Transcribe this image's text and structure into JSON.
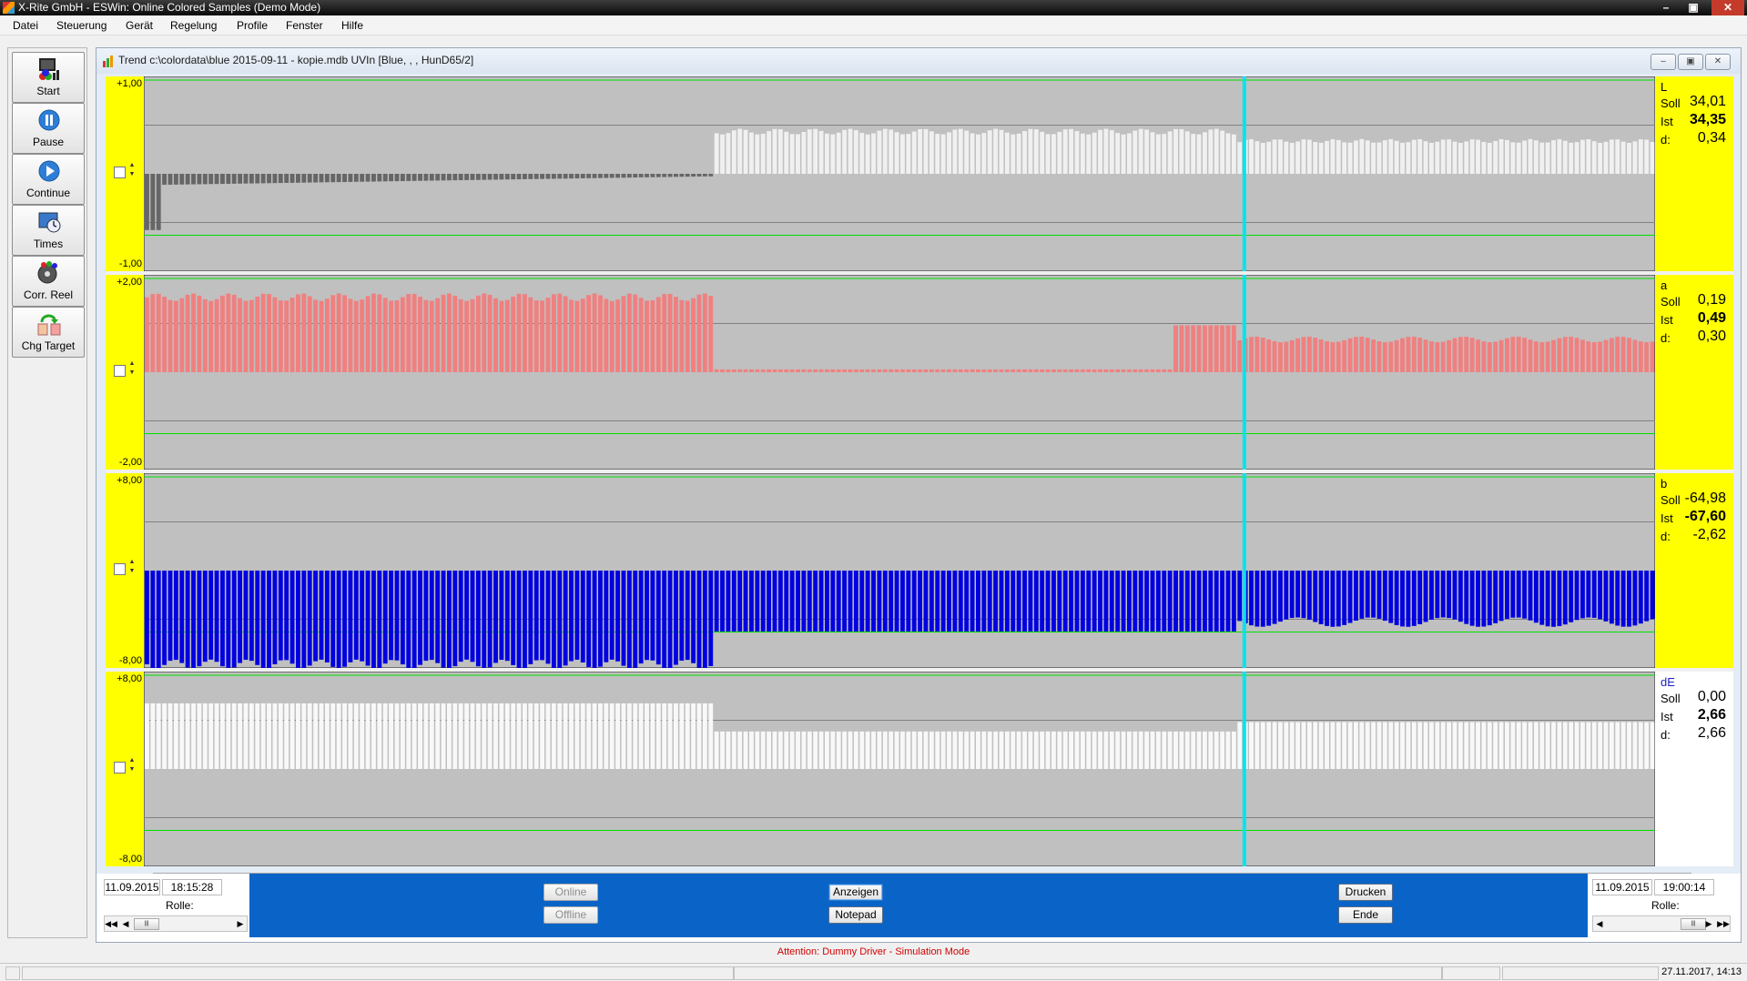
{
  "window": {
    "title": "X-Rite GmbH - ESWin: Online Colored Samples (Demo Mode)",
    "controls": [
      "–",
      "▣",
      "✕"
    ]
  },
  "menu": [
    "Datei",
    "Steuerung",
    "Gerät",
    "Regelung",
    "Profile",
    "Fenster",
    "Hilfe"
  ],
  "toolbar": [
    {
      "label": "Start",
      "icon": "start-icon"
    },
    {
      "label": "Pause",
      "icon": "pause-icon"
    },
    {
      "label": "Continue",
      "icon": "continue-icon"
    },
    {
      "label": "Times",
      "icon": "times-icon"
    },
    {
      "label": "Corr. Reel",
      "icon": "corr-reel-icon"
    },
    {
      "label": "Chg Target",
      "icon": "chg-target-icon"
    }
  ],
  "trend": {
    "title": "Trend c:\\colordata\\blue 2015-09-11 - kopie.mdb UVIn [Blue, , , HunD65/2]",
    "controls": [
      "–",
      "▣",
      "✕"
    ],
    "panels": [
      {
        "name": "L",
        "ymax": "+1,00",
        "ymin": "-1,00",
        "soll": "34,01",
        "ist": "34,35",
        "d": "0,34",
        "info_bg": "#ffff00",
        "bar_color": "#f0f0f0",
        "neg_color": "#666666"
      },
      {
        "name": "a",
        "ymax": "+2,00",
        "ymin": "-2,00",
        "soll": "0,19",
        "ist": "0,49",
        "d": "0,30",
        "info_bg": "#ffff00",
        "bar_color": "#f08080",
        "neg_color": "#f08080"
      },
      {
        "name": "b",
        "ymax": "+8,00",
        "ymin": "-8,00",
        "soll": "-64,98",
        "ist": "-67,60",
        "d": "-2,62",
        "info_bg": "#ffff00",
        "bar_color": "#0000e0",
        "neg_color": "#0000e0"
      },
      {
        "name": "dE",
        "ymax": "+8,00",
        "ymin": "-8,00",
        "soll": "0,00",
        "ist": "2,66",
        "d": "2,66",
        "info_bg": "#ffffff",
        "bar_color": "#f8f8f8",
        "neg_color": "#f8f8f8"
      }
    ],
    "labels": {
      "soll": "Soll",
      "ist": "Ist",
      "d": "d:"
    },
    "colors": {
      "yaxis": "#ffff00",
      "plot_bg": "#c0c0c0",
      "tolerance_line": "#00e000",
      "cursor": "#00e5ee",
      "grid": "#808080"
    },
    "cursor_fraction": 0.727
  },
  "bottom": {
    "left": {
      "date": "11.09.2015",
      "time": "18:15:28",
      "rolle": "Rolle:"
    },
    "right": {
      "date": "11.09.2015",
      "time": "19:00:14",
      "rolle": "Rolle:"
    },
    "buttons": {
      "online": "Online",
      "offline": "Offline",
      "anzeigen": "Anzeigen",
      "notepad": "Notepad",
      "drucken": "Drucken",
      "ende": "Ende"
    }
  },
  "status": {
    "attention": "Attention: Dummy Driver - Simulation Mode",
    "datetime": "27.11.2017, 14:13"
  }
}
